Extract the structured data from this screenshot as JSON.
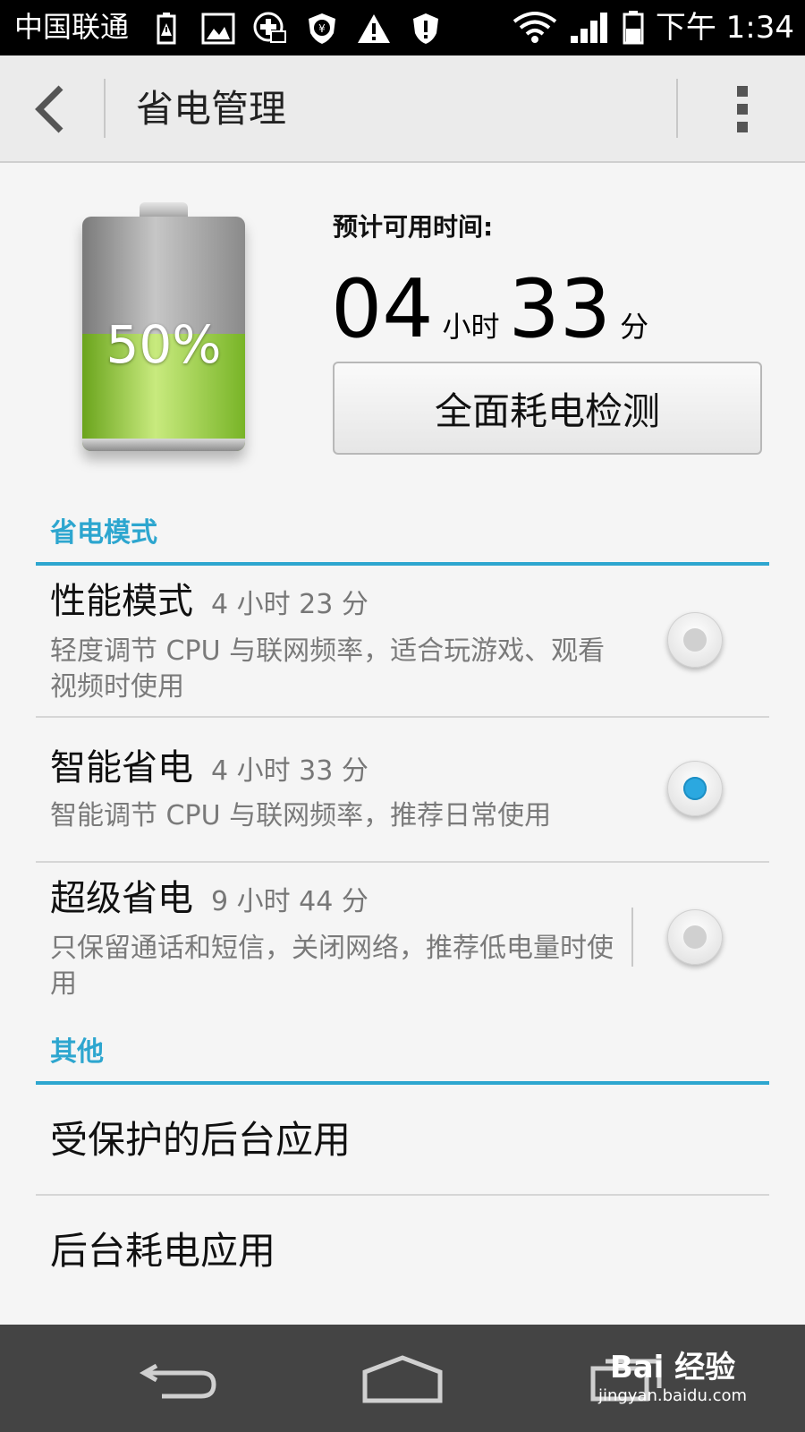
{
  "status_bar": {
    "carrier": "中国联通",
    "time": "下午 1:34",
    "icons": [
      "battery-alert-icon",
      "image-icon",
      "add-sms-icon",
      "yuan-shield-icon",
      "warning-icon",
      "shield-alert-icon",
      "wifi-icon",
      "signal-icon",
      "battery-icon"
    ]
  },
  "action_bar": {
    "title": "省电管理",
    "back_icon": "back-icon",
    "menu_icon": "overflow-menu-icon"
  },
  "battery": {
    "percent_label": "50%",
    "level": 0.5
  },
  "estimate": {
    "label": "预计可用时间:",
    "hours": "04",
    "hours_unit": "小时",
    "minutes": "33",
    "minutes_unit": "分"
  },
  "check_button": {
    "label": "全面耗电检测"
  },
  "power_modes": {
    "header": "省电模式",
    "items": [
      {
        "name": "性能模式",
        "time": "4 小时 23 分",
        "desc": "轻度调节 CPU 与联网频率，适合玩游戏、观看视频时使用",
        "selected": false
      },
      {
        "name": "智能省电",
        "time": "4 小时 33 分",
        "desc": "智能调节 CPU 与联网频率，推荐日常使用",
        "selected": true
      },
      {
        "name": "超级省电",
        "time": "9 小时 44 分",
        "desc": "只保留通话和短信，关闭网络，推荐低电量时使用",
        "selected": false
      }
    ]
  },
  "others": {
    "header": "其他",
    "items": [
      {
        "label": "受保护的后台应用"
      },
      {
        "label": "后台耗电应用"
      }
    ]
  },
  "nav_bar": {
    "buttons": [
      "back-icon",
      "home-icon",
      "recent-apps-icon"
    ]
  },
  "watermark": {
    "main": "Bai 经验",
    "sub": "jingyan.baidu.com"
  },
  "colors": {
    "accent": "#2da6cf",
    "radio_selected": "#2ba8e0",
    "battery_green": "#8cc63f"
  }
}
